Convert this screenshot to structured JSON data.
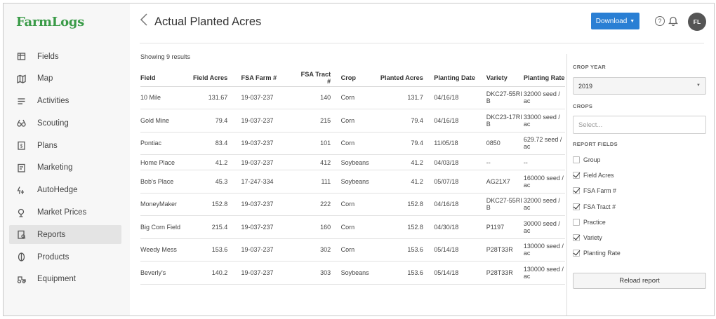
{
  "app": {
    "logo": "FarmLogs"
  },
  "sidebar": {
    "items": [
      {
        "label": "Fields",
        "icon": "fields-icon",
        "active": false
      },
      {
        "label": "Map",
        "icon": "map-icon",
        "active": false
      },
      {
        "label": "Activities",
        "icon": "activities-icon",
        "active": false
      },
      {
        "label": "Scouting",
        "icon": "binoculars-icon",
        "active": false
      },
      {
        "label": "Plans",
        "icon": "plans-icon",
        "active": false
      },
      {
        "label": "Marketing",
        "icon": "marketing-icon",
        "active": false
      },
      {
        "label": "AutoHedge",
        "icon": "autohedge-icon",
        "active": false
      },
      {
        "label": "Market Prices",
        "icon": "market-prices-icon",
        "active": false
      },
      {
        "label": "Reports",
        "icon": "reports-icon",
        "active": true
      },
      {
        "label": "Products",
        "icon": "products-icon",
        "active": false
      },
      {
        "label": "Equipment",
        "icon": "equipment-icon",
        "active": false
      }
    ]
  },
  "header": {
    "title": "Actual Planted Acres",
    "download_label": "Download",
    "download_caret": "▼",
    "help_glyph": "?",
    "avatar_initials": "FL"
  },
  "report": {
    "results_text": "Showing 9 results",
    "columns": [
      "Field",
      "Field Acres",
      "FSA Farm #",
      "FSA Tract #",
      "Crop",
      "Planted Acres",
      "Planting Date",
      "Variety",
      "Planting Rate"
    ],
    "rows": [
      [
        "10 Mile",
        "131.67",
        "19-037-237",
        "140",
        "Corn",
        "131.7",
        "04/16/18",
        "DKC27-55RIB",
        "32000 seed / ac"
      ],
      [
        "Gold Mine",
        "79.4",
        "19-037-237",
        "215",
        "Corn",
        "79.4",
        "04/16/18",
        "DKC23-17RIB",
        "33000 seed / ac"
      ],
      [
        "Pontiac",
        "83.4",
        "19-037-237",
        "101",
        "Corn",
        "79.4",
        "11/05/18",
        "0850",
        "629.72 seed / ac"
      ],
      [
        "Home Place",
        "41.2",
        "19-037-237",
        "412",
        "Soybeans",
        "41.2",
        "04/03/18",
        "--",
        "--"
      ],
      [
        "Bob's Place",
        "45.3",
        "17-247-334",
        "111",
        "Soybeans",
        "41.2",
        "05/07/18",
        "AG21X7",
        "160000 seed / ac"
      ],
      [
        "MoneyMaker",
        "152.8",
        "19-037-237",
        "222",
        "Corn",
        "152.8",
        "04/16/18",
        "DKC27-55RIB",
        "32000 seed / ac"
      ],
      [
        "Big Corn Field",
        "215.4",
        "19-037-237",
        "160",
        "Corn",
        "152.8",
        "04/30/18",
        "P1197",
        "30000 seed / ac"
      ],
      [
        "Weedy Mess",
        "153.6",
        "19-037-237",
        "302",
        "Corn",
        "153.6",
        "05/14/18",
        "P28T33R",
        "130000 seed / ac"
      ],
      [
        "Beverly's",
        "140.2",
        "19-037-237",
        "303",
        "Soybeans",
        "153.6",
        "05/14/18",
        "P28T33R",
        "130000 seed / ac"
      ]
    ]
  },
  "filters": {
    "crop_year_label": "CROP YEAR",
    "crop_year_value": "2019",
    "crops_label": "CROPS",
    "crops_placeholder": "Select...",
    "report_fields_label": "REPORT FIELDS",
    "report_fields": [
      {
        "label": "Group",
        "checked": false
      },
      {
        "label": "Field Acres",
        "checked": true
      },
      {
        "label": "FSA Farm #",
        "checked": true
      },
      {
        "label": "FSA Tract #",
        "checked": true
      },
      {
        "label": "Practice",
        "checked": false
      },
      {
        "label": "Variety",
        "checked": true
      },
      {
        "label": "Planting Rate",
        "checked": true
      }
    ],
    "reload_label": "Reload report"
  },
  "colors": {
    "brand": "#3a9b48",
    "accent": "#2a7fd4"
  }
}
